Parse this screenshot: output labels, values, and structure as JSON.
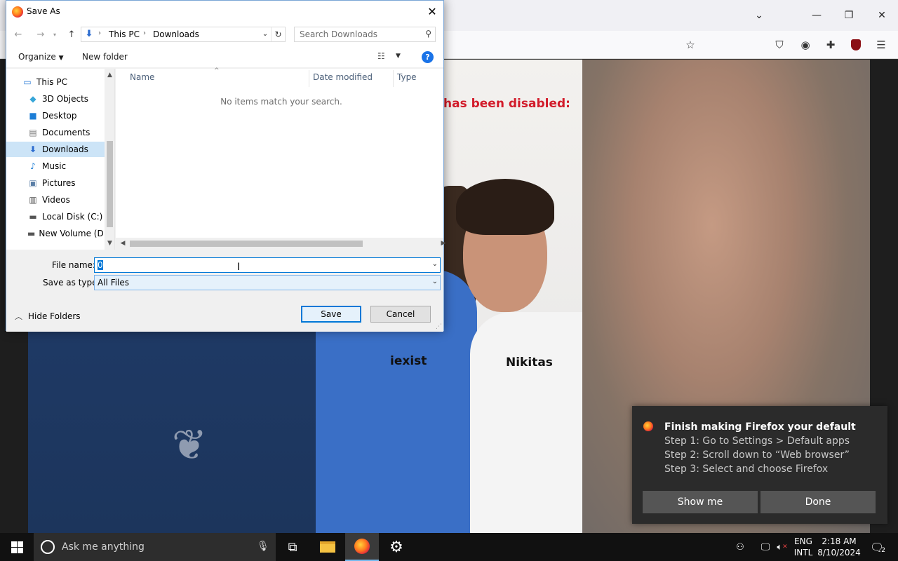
{
  "dialog": {
    "title": "Save As",
    "address": {
      "root": "This PC",
      "folder": "Downloads"
    },
    "search": {
      "placeholder": "Search Downloads"
    },
    "commands": {
      "organize": "Organize",
      "new_folder": "New folder"
    },
    "nav_items": [
      {
        "label": "This PC",
        "icon": "computer-icon"
      },
      {
        "label": "3D Objects",
        "icon": "cube-icon"
      },
      {
        "label": "Desktop",
        "icon": "desktop-icon"
      },
      {
        "label": "Documents",
        "icon": "document-icon"
      },
      {
        "label": "Downloads",
        "icon": "download-icon",
        "selected": true
      },
      {
        "label": "Music",
        "icon": "music-note-icon"
      },
      {
        "label": "Pictures",
        "icon": "picture-icon"
      },
      {
        "label": "Videos",
        "icon": "film-icon"
      },
      {
        "label": "Local Disk (C:)",
        "icon": "drive-icon"
      },
      {
        "label": "New Volume (D:",
        "icon": "drive-icon"
      }
    ],
    "columns": {
      "name": "Name",
      "date_modified": "Date modified",
      "type": "Type"
    },
    "empty_message": "No items match your search.",
    "file_name_label": "File name:",
    "file_name_value": "0",
    "save_type_label": "Save as type:",
    "save_type_value": "All Files",
    "hide_folders": "Hide Folders",
    "save_label": "Save",
    "cancel_label": "Cancel"
  },
  "page": {
    "disabled_text": "has been disabled:",
    "label_left": "iexist",
    "label_right": "Nikitas"
  },
  "notification": {
    "title": "Finish making Firefox your default",
    "step1": "Step 1: Go to Settings > Default apps",
    "step2": "Step 2: Scroll down to “Web browser”",
    "step3": "Step 3: Select and choose Firefox",
    "show_me": "Show me",
    "done": "Done"
  },
  "taskbar": {
    "search_placeholder": "Ask me anything",
    "lang_top": "ENG",
    "lang_bottom": "INTL",
    "time": "2:18 AM",
    "date": "8/10/2024",
    "notification_count": "2"
  },
  "colors": {
    "accent": "#0078d7",
    "selected_bg": "#cce4f7",
    "notif_bg": "#2b2b2b",
    "taskbar_bg": "#111111"
  }
}
